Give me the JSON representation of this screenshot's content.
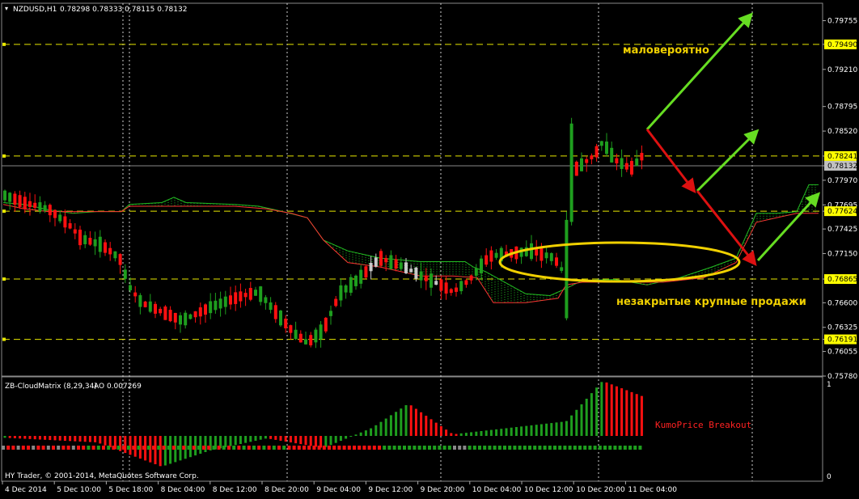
{
  "header": {
    "symbol": "NZDUSD,H1",
    "ohlc": "0.78298 0.78333 0.78115 0.78132"
  },
  "indicator": {
    "title": "ZB-CloudMatrix (8,29,34)",
    "ao_label": "AO 0.007269",
    "breakout_label": "KumoPrice Breakout",
    "scale_top": "1",
    "scale_bottom": "0"
  },
  "copyright": "HY Trader, © 2001-2014, MetaQuotes Software Corp.",
  "annotations": {
    "unlikely": "маловероятно",
    "unclosed_sales": "незакрытые крупные продажи"
  },
  "colors": {
    "background": "#000000",
    "bull_candle": "#1e9e1e",
    "bear_candle": "#ff1010",
    "doji_candle": "#c8c8c8",
    "level_line": "#e8e800",
    "arrow_green": "#66dd22",
    "arrow_red": "#dd1111",
    "ellipse": "#f0d000",
    "kumo_green": "#22bb22",
    "kumo_red": "#ff3333",
    "text": "#ffffff",
    "label_box_yellow": "#ffff00",
    "label_box_grey": "#c0c0c0"
  },
  "chart_data": [
    {
      "type": "candlestick",
      "symbol": "NZDUSD",
      "timeframe": "H1",
      "y_ticks": [
        "0.79755",
        "0.79490",
        "0.79210",
        "0.78795",
        "0.78520",
        "0.78241",
        "0.78132",
        "0.77970",
        "0.77695",
        "0.77624",
        "0.77425",
        "0.77150",
        "0.76865",
        "0.76600",
        "0.76325",
        "0.76191",
        "0.76055",
        "0.75780"
      ],
      "ylim": [
        0.7578,
        0.7995
      ],
      "x_ticks": [
        "4 Dec 2014",
        "5 Dec 10:00",
        "5 Dec 18:00",
        "8 Dec 04:00",
        "8 Dec 12:00",
        "8 Dec 20:00",
        "9 Dec 04:00",
        "9 Dec 12:00",
        "9 Dec 20:00",
        "10 Dec 04:00",
        "10 Dec 12:00",
        "10 Dec 20:00",
        "11 Dec 04:00"
      ],
      "horizontal_levels": [
        "0.79490",
        "0.78241",
        "0.77624",
        "0.76865",
        "0.76191"
      ],
      "current_price": "0.78132",
      "grid": true
    },
    {
      "type": "bar",
      "title": "ZB-CloudMatrix (8,29,34)",
      "ylim": [
        0,
        1
      ]
    }
  ]
}
